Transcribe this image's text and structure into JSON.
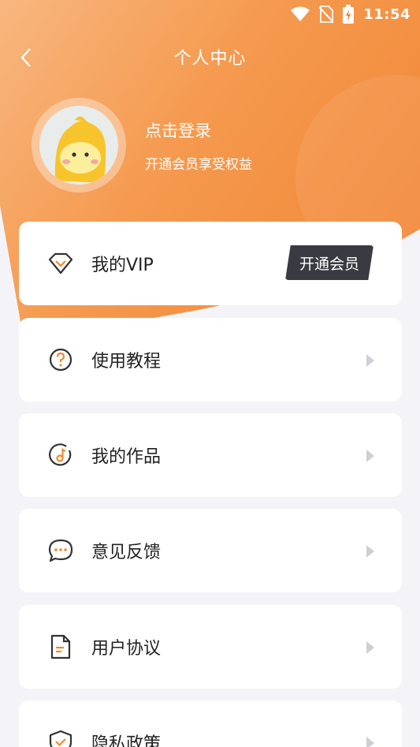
{
  "status": {
    "time": "11:54"
  },
  "header": {
    "title": "个人中心"
  },
  "profile": {
    "login": "点击登录",
    "tagline": "开通会员享受权益"
  },
  "vip": {
    "label": "我的VIP",
    "button": "开通会员"
  },
  "menu": [
    {
      "label": "使用教程",
      "icon": "question-circle-icon"
    },
    {
      "label": "我的作品",
      "icon": "music-disc-icon"
    },
    {
      "label": "意见反馈",
      "icon": "chat-bubble-icon"
    },
    {
      "label": "用户协议",
      "icon": "document-icon"
    },
    {
      "label": "隐私政策",
      "icon": "shield-check-icon"
    }
  ],
  "colors": {
    "accent": "#f07f2d",
    "icon_orange": "#f08a2c",
    "button_dark": "#3a3a42"
  }
}
